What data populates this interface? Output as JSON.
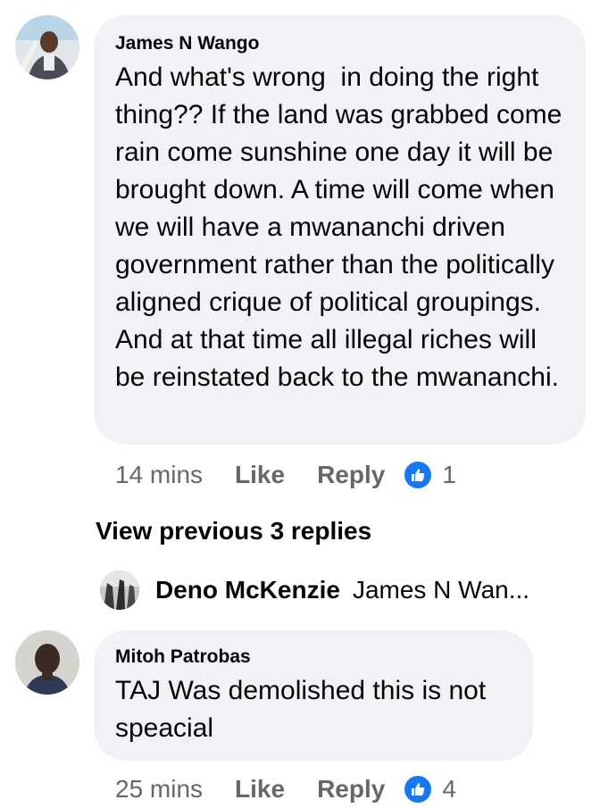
{
  "comments": [
    {
      "author": "James N Wango",
      "text": "And what's wrong  in doing the right thing?? If the land was grabbed come rain come sunshine one day it will be brought down. A time will come when we will have a mwananchi driven government rather than the politically aligned crique of political groupings. And at that time all illegal riches will be reinstated back to the mwananchi.",
      "time": "14 mins",
      "like_label": "Like",
      "reply_label": "Reply",
      "reaction_count": "1"
    },
    {
      "author": "Mitoh Patrobas",
      "text": "TAJ Was demolished this is not speacial",
      "time": "25 mins",
      "like_label": "Like",
      "reply_label": "Reply",
      "reaction_count": "4"
    }
  ],
  "replies": {
    "view_previous_label": "View previous 3 replies",
    "latest_reply": {
      "author": "Deno McKenzie",
      "snippet": "James N Wan..."
    }
  },
  "icons": {
    "like_badge": "thumbs-up-icon",
    "like_badge_color": "#1877f2"
  },
  "colors": {
    "bubble_background": "#f0f2f5",
    "meta_text": "#65676b"
  }
}
